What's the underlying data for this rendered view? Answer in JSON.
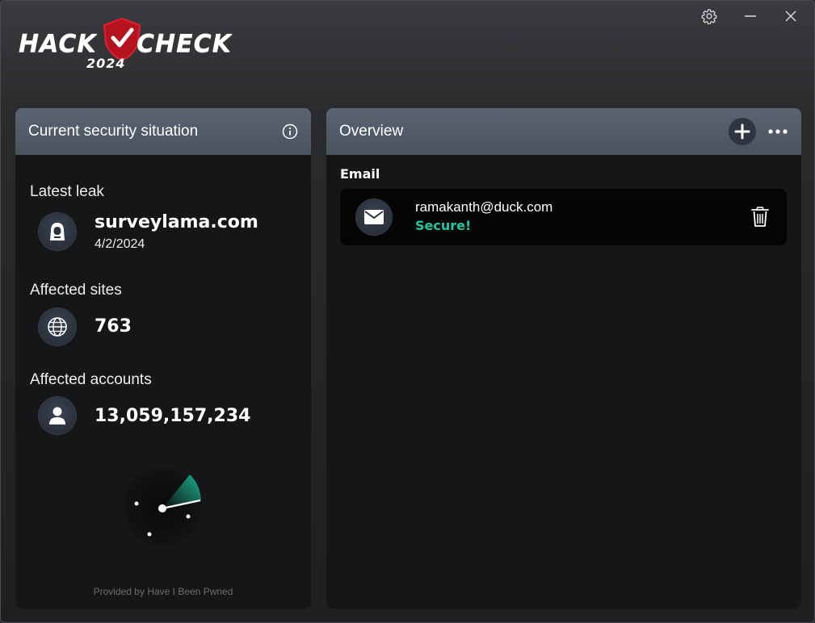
{
  "app": {
    "logo_left": "HACK",
    "logo_right": "CHECK",
    "logo_year": "2024",
    "accent_color": "#e0202e"
  },
  "window_controls": {
    "settings_icon": "gear-icon",
    "minimize_icon": "minimize-icon",
    "close_icon": "close-icon"
  },
  "security_panel": {
    "title": "Current security situation",
    "latest_leak": {
      "label": "Latest leak",
      "site": "surveylama.com",
      "date": "4/2/2024"
    },
    "affected_sites": {
      "label": "Affected sites",
      "value": "763"
    },
    "affected_accounts": {
      "label": "Affected accounts",
      "value": "13,059,157,234"
    },
    "provided_by": "Provided by Have I Been Pwned"
  },
  "overview_panel": {
    "title": "Overview",
    "email_section_label": "Email",
    "emails": [
      {
        "address": "ramakanth@duck.com",
        "status": "Secure!",
        "status_color": "#1ec8a0"
      }
    ]
  }
}
